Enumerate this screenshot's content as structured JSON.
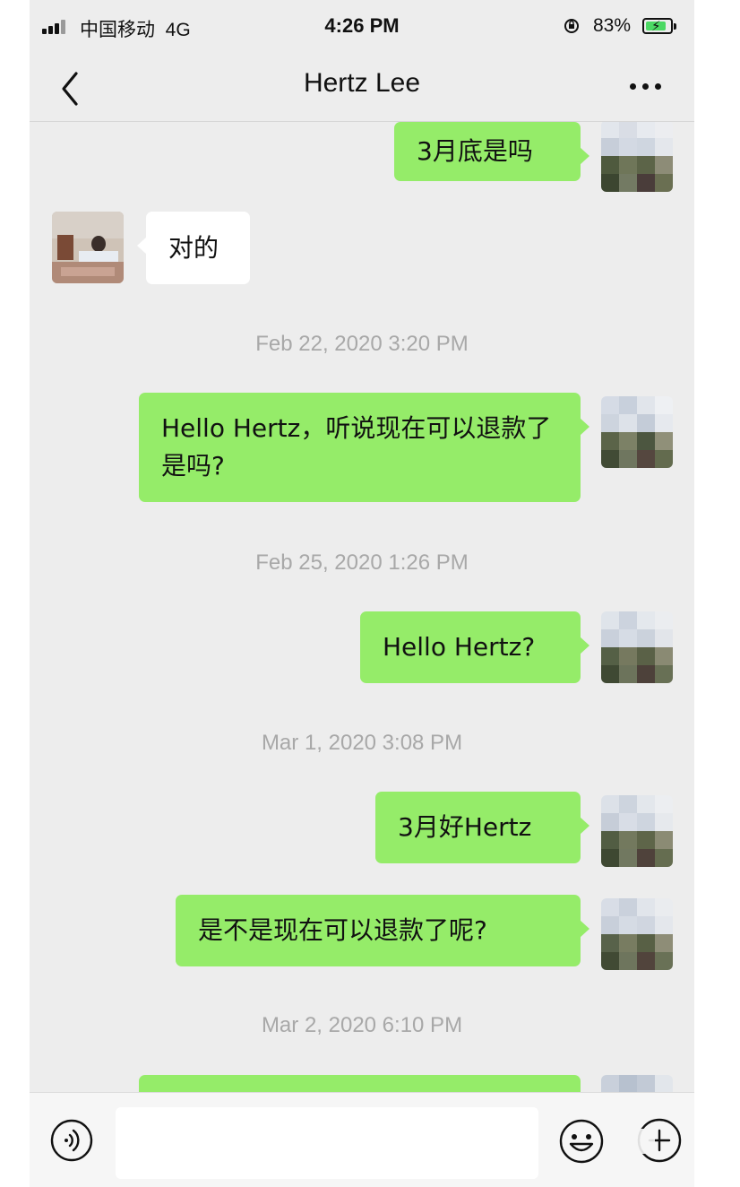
{
  "status_bar": {
    "carrier": "中国移动",
    "network": "4G",
    "time": "4:26 PM",
    "battery_percent": "83%",
    "battery_level": 0.83,
    "rotation_lock_icon": "orientation-lock-icon",
    "battery_charging": true
  },
  "nav": {
    "title": "Hertz Lee",
    "back_icon": "chevron-left-icon",
    "more_icon": "more-dots-icon"
  },
  "messages": [
    {
      "type": "msg",
      "from": "me",
      "text": "3月底是吗"
    },
    {
      "type": "msg",
      "from": "them",
      "text": "对的"
    },
    {
      "type": "time",
      "text": "Feb 22, 2020 3:20 PM"
    },
    {
      "type": "msg",
      "from": "me",
      "text": "Hello Hertz，听说现在可以退款了是吗?"
    },
    {
      "type": "time",
      "text": "Feb 25, 2020 1:26 PM"
    },
    {
      "type": "msg",
      "from": "me",
      "text": "Hello Hertz?"
    },
    {
      "type": "time",
      "text": "Mar 1, 2020 3:08 PM"
    },
    {
      "type": "msg",
      "from": "me",
      "text": "3月好Hertz"
    },
    {
      "type": "msg",
      "from": "me",
      "text": "是不是现在可以退款了呢?"
    },
    {
      "type": "time",
      "text": "Mar 2, 2020 6:10 PM"
    },
    {
      "type": "msg",
      "from": "me",
      "text": ""
    }
  ],
  "input_bar": {
    "voice_icon": "voice-icon",
    "emoji_icon": "emoji-icon",
    "more_icon": "plus-circle-icon",
    "input_value": ""
  },
  "colors": {
    "my_bubble": "#95ec69",
    "their_bubble": "#ffffff",
    "background": "#ededed"
  }
}
